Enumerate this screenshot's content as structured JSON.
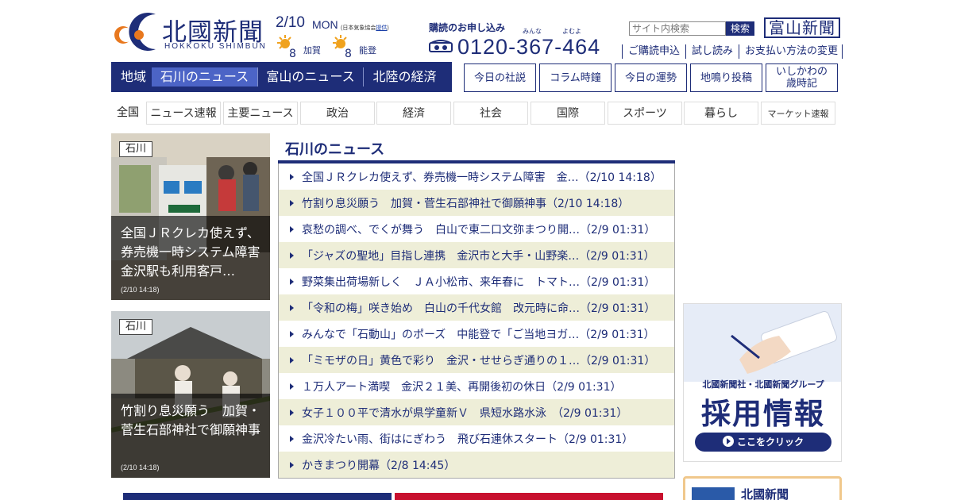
{
  "header": {
    "logo_jp": "北國新聞",
    "logo_en": "HOKKOKU SHIMBUN"
  },
  "weather": {
    "date": "2/10",
    "day": "MON",
    "credit_prefix": "(日本気象協会",
    "credit_link": "提供",
    "credit_suffix": ")",
    "areas": [
      {
        "icon": "sun-cloud-icon",
        "label": "加賀"
      },
      {
        "icon": "sun-cloud-icon",
        "label": "能登"
      }
    ]
  },
  "subscription": {
    "title": "購読のお申し込み",
    "ruby_1": "みんな",
    "ruby_2": "よむよ",
    "phone": "0120-367-464"
  },
  "search": {
    "placeholder": "サイト内検索",
    "button": "検索"
  },
  "toyama_button": "富山新聞",
  "links": [
    "ご購読申込",
    "試し読み",
    "お支払い方法の変更"
  ],
  "region_nav": {
    "label": "地域",
    "items": [
      {
        "label": "石川のニュース",
        "active": true
      },
      {
        "label": "富山のニュース",
        "active": false
      },
      {
        "label": "北陸の経済",
        "active": false
      }
    ]
  },
  "feature_buttons": [
    "今日の社説",
    "コラム時鐘",
    "今日の運勢",
    "地鳴り投稿",
    "いしかわの\n歳時記"
  ],
  "categories": [
    "全国",
    "ニュース速報",
    "主要ニュース",
    "政治",
    "経済",
    "社会",
    "国際",
    "スポーツ",
    "暮らし",
    "マーケット速報"
  ],
  "photos": [
    {
      "badge": "石川",
      "title": "全国ＪＲクレカ使えず、券売機一時システム障害　金沢駅も利用客戸…",
      "date": "(2/10 14:18)"
    },
    {
      "badge": "石川",
      "title": "竹割り息災願う　加賀・菅生石部神社で御願神事",
      "date": "(2/10 14:18)"
    }
  ],
  "news": {
    "title": "石川のニュース",
    "items": [
      "全国ＪＲクレカ使えず、券売機一時システム障害　金…（2/10 14:18）",
      "竹割り息災願う　加賀・菅生石部神社で御願神事（2/10 14:18）",
      "哀愁の調べ、でくが舞う　白山で東二口文弥まつり開…（2/9 01:31）",
      "「ジャズの聖地」目指し連携　金沢市と大手・山野楽…（2/9 01:31）",
      "野菜集出荷場新しく　ＪＡ小松市、来年春に　トマト…（2/9 01:31）",
      "「令和の梅」咲き始め　白山の千代女館　改元時に命…（2/9 01:31）",
      "みんなで「石動山」のポーズ　中能登で「ご当地ヨガ…（2/9 01:31）",
      "「ミモザの日」黄色で彩り　金沢・せせらぎ通りの１…（2/9 01:31）",
      "１万人アート満喫　金沢２１美、再開後初の休日（2/9 01:31）",
      "女子１００平で清水が県学童新Ｖ　県短水路水泳　（2/9 01:31）",
      "金沢冷たい雨、街はにぎわう　飛び石連休スタート（2/9 01:31）",
      "かきまつり開幕（2/8 14:45）"
    ]
  },
  "recruit_ad": {
    "sub": "北國新聞社・北國新聞グループ",
    "main": "採用情報",
    "click": "ここをクリック"
  },
  "app_card": {
    "name": "北國新聞"
  },
  "colors": {
    "brand_navy": "#1e2d78",
    "active_tab": "#4c64c6",
    "row_alt": "#eeeed8"
  }
}
